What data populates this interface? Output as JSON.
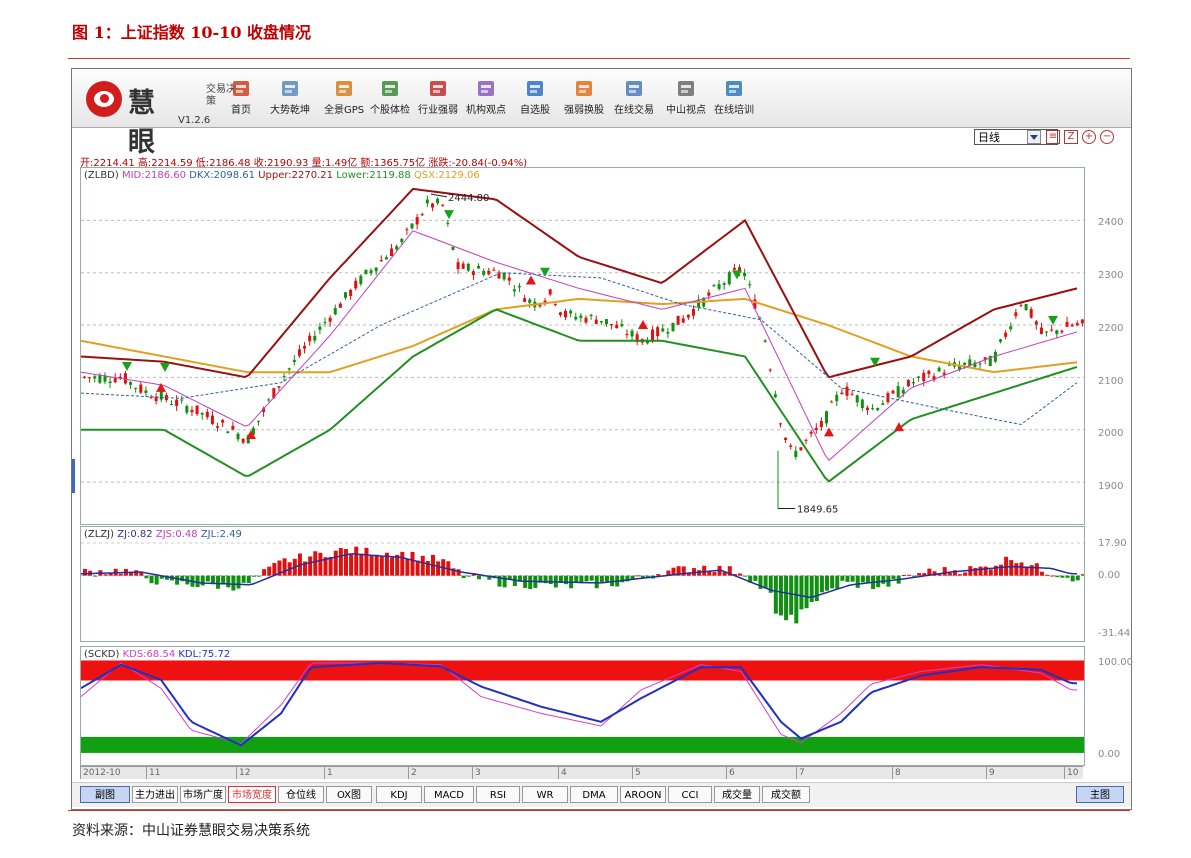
{
  "caption": "图 1：上证指数 10-10 收盘情况",
  "source": "资料来源：中山证券慧眼交易决策系统",
  "app": {
    "logo_name": "慧眼",
    "logo_sub": "交易决策",
    "version": "V1.2.6",
    "toolbar": [
      {
        "label": "首页",
        "icon": "home-icon"
      },
      {
        "label": "大势乾坤",
        "icon": "magnifier-document-icon"
      },
      {
        "label": "全景GPS",
        "icon": "grid-icon"
      },
      {
        "label": "个股体检",
        "icon": "checklist-icon"
      },
      {
        "label": "行业强弱",
        "icon": "bar-chart-icon"
      },
      {
        "label": "机构观点",
        "icon": "people-icon"
      },
      {
        "label": "自选股",
        "icon": "box-icon"
      },
      {
        "label": "强弱换股",
        "icon": "swap-icon"
      },
      {
        "label": "在线交易",
        "icon": "cart-icon"
      },
      {
        "label": "中山视点",
        "icon": "document-icon"
      },
      {
        "label": "在线培训",
        "icon": "monitor-icon"
      }
    ],
    "period": "日线",
    "stats": "开:2214.41  高:2214.59  低:2186.48  收:2190.93  量:1.49亿  额:1365.75亿  涨跌:-20.84(-0.94%)"
  },
  "zlbd": {
    "name": "(ZLBD)",
    "mid": "MID:2186.60",
    "dkx": "DKX:2098.61",
    "upper": "Upper:2270.21",
    "lower": "Lower:2119.88",
    "qsx": "QSX:2129.06",
    "high_annotation": "2444.80",
    "low_annotation": "1849.65",
    "yticks": [
      "2400",
      "2300",
      "2200",
      "2100",
      "2000",
      "1900"
    ]
  },
  "zlzj": {
    "name": "(ZLZJ)",
    "zj": "ZJ:0.82",
    "zjs": "ZJS:0.48",
    "zjl": "ZJL:2.49",
    "yticks": [
      "17.90",
      "0.00",
      "-31.44"
    ]
  },
  "sckd": {
    "name": "(SCKD)",
    "kds": "KDS:68.54",
    "kdl": "KDL:75.72",
    "yticks": [
      "100.00",
      "0.00"
    ]
  },
  "x_axis": [
    "2012-10",
    "11",
    "12",
    "1",
    "2",
    "3",
    "4",
    "5",
    "6",
    "7",
    "8",
    "9",
    "10"
  ],
  "tabs": [
    "副图",
    "主力进出",
    "市场广度",
    "市场宽度",
    "仓位线",
    "OX图",
    "KDJ",
    "MACD",
    "RSI",
    "WR",
    "DMA",
    "AROON",
    "CCI",
    "成交量",
    "成交额"
  ],
  "main_button": "主图",
  "colors": {
    "up": "#e01010",
    "down": "#109010",
    "upper_band": "#9a1010",
    "lower_band": "#209020",
    "mid": "#c040c0",
    "dkx": "#3060a0",
    "qsx": "#e0a020",
    "kds": "#d040d0",
    "kdl": "#2030c0"
  },
  "chart_data": [
    {
      "type": "line",
      "title": "(ZLBD)",
      "series": [
        {
          "name": "MID",
          "x": [
            "2012-10",
            "2012-11",
            "2012-12",
            "2013-01",
            "2013-02",
            "2013-03",
            "2013-04",
            "2013-05",
            "2013-06",
            "2013-07",
            "2013-08",
            "2013-09",
            "2013-10"
          ],
          "values": [
            2110,
            2085,
            2005,
            2180,
            2380,
            2320,
            2270,
            2230,
            2270,
            1940,
            2080,
            2140,
            2187
          ]
        },
        {
          "name": "Upper",
          "x": [
            "2012-10",
            "2012-11",
            "2012-12",
            "2013-01",
            "2013-02",
            "2013-03",
            "2013-04",
            "2013-05",
            "2013-06",
            "2013-07",
            "2013-08",
            "2013-09",
            "2013-10"
          ],
          "values": [
            2140,
            2130,
            2100,
            2290,
            2460,
            2440,
            2330,
            2280,
            2400,
            2100,
            2140,
            2230,
            2270
          ]
        },
        {
          "name": "Lower",
          "x": [
            "2012-10",
            "2012-11",
            "2012-12",
            "2013-01",
            "2013-02",
            "2013-03",
            "2013-04",
            "2013-05",
            "2013-06",
            "2013-07",
            "2013-08",
            "2013-09",
            "2013-10"
          ],
          "values": [
            2000,
            2000,
            1910,
            2000,
            2140,
            2230,
            2170,
            2170,
            2140,
            1900,
            2020,
            2070,
            2120
          ]
        },
        {
          "name": "QSX",
          "x": [
            "2012-10",
            "2012-11",
            "2012-12",
            "2013-01",
            "2013-02",
            "2013-03",
            "2013-04",
            "2013-05",
            "2013-06",
            "2013-07",
            "2013-08",
            "2013-09",
            "2013-10"
          ],
          "values": [
            2170,
            2140,
            2110,
            2110,
            2160,
            2230,
            2250,
            2240,
            2250,
            2200,
            2140,
            2110,
            2129
          ]
        }
      ],
      "ylim": [
        1820,
        2500
      ],
      "annotations": [
        "2444.80",
        "1849.65"
      ]
    },
    {
      "type": "bar",
      "title": "(ZLZJ)",
      "ylim": [
        -31.44,
        17.9
      ]
    },
    {
      "type": "line",
      "title": "(SCKD)",
      "ylim": [
        0,
        100
      ]
    }
  ]
}
